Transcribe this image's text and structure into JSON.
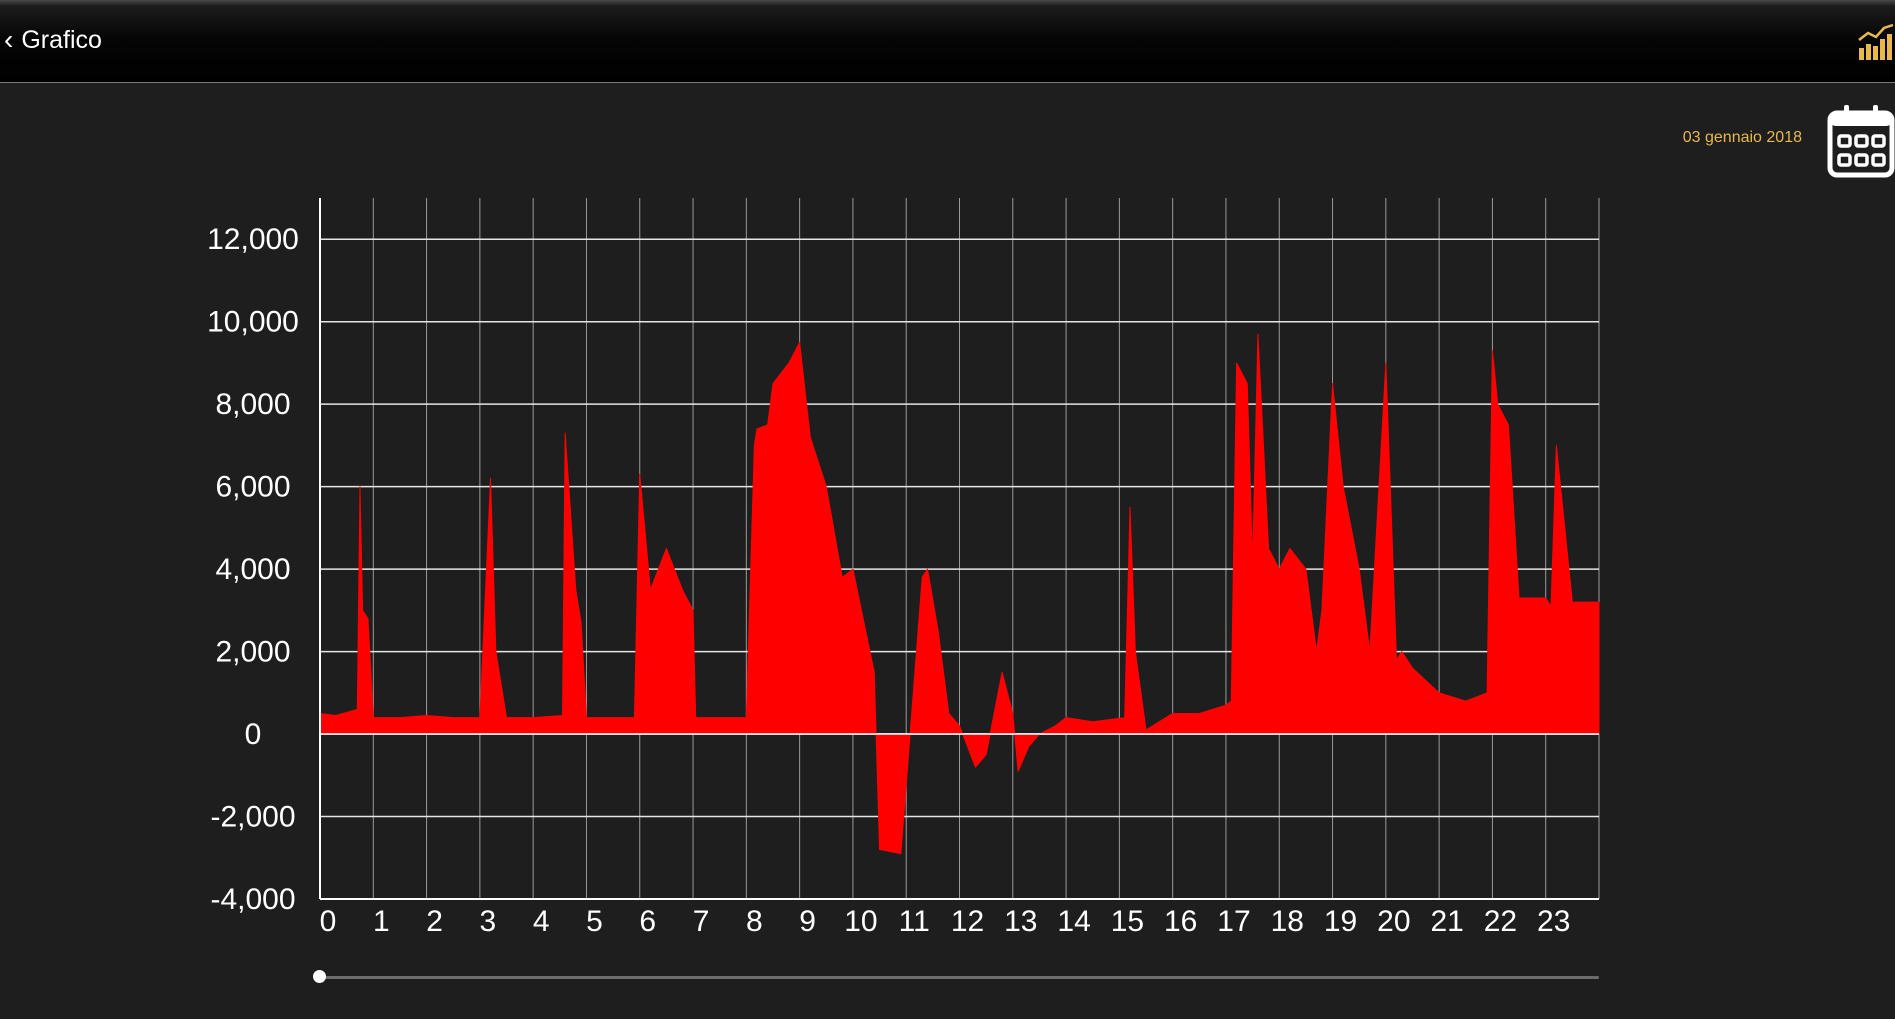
{
  "nav": {
    "back_chevron": "‹",
    "title": "Grafico",
    "chart_icon": "bar-line-chart-icon",
    "accent": "#e8b94a"
  },
  "date_label": "03 gennaio 2018",
  "calendar_icon": "calendar-icon",
  "slider": {
    "value": 0
  },
  "chart_data": {
    "type": "area",
    "title": "",
    "xlabel": "",
    "ylabel": "",
    "x_ticks": [
      "0",
      "1",
      "2",
      "3",
      "4",
      "5",
      "6",
      "7",
      "8",
      "9",
      "10",
      "11",
      "12",
      "13",
      "14",
      "15",
      "16",
      "17",
      "18",
      "19",
      "20",
      "21",
      "22",
      "23"
    ],
    "y_ticks": [
      "-4,000",
      "-2,000",
      "0",
      "2,000",
      "4,000",
      "6,000",
      "8,000",
      "10,000",
      "12,000"
    ],
    "xlim": [
      0,
      24
    ],
    "ylim": [
      -4000,
      13000
    ],
    "grid": true,
    "color": "#ff0000",
    "series": [
      {
        "x": [
          0,
          0.3,
          0.7,
          0.75,
          0.8,
          0.9,
          1.0,
          1.5,
          2.0,
          2.5,
          2.9,
          3.0,
          3.2,
          3.3,
          3.5,
          4.0,
          4.55,
          4.6,
          4.8,
          4.9,
          5.0,
          5.5,
          5.9,
          6.0,
          6.2,
          6.5,
          6.8,
          7.0,
          7.05,
          7.5,
          8.0,
          8.15,
          8.2,
          8.4,
          8.5,
          8.8,
          9.0,
          9.2,
          9.5,
          9.8,
          10.0,
          10.4,
          10.5,
          10.9,
          11.3,
          11.4,
          11.6,
          11.8,
          12.0,
          12.3,
          12.5,
          12.8,
          13.0,
          13.1,
          13.3,
          13.5,
          13.8,
          14.0,
          14.5,
          15.1,
          15.2,
          15.3,
          15.5,
          16.0,
          16.5,
          17.0,
          17.1,
          17.2,
          17.4,
          17.5,
          17.6,
          17.8,
          18.0,
          18.2,
          18.5,
          18.7,
          18.8,
          19.0,
          19.2,
          19.5,
          19.7,
          20.0,
          20.2,
          20.3,
          20.5,
          21.0,
          21.5,
          21.9,
          22.0,
          22.1,
          22.3,
          22.5,
          23.0,
          23.1,
          23.2,
          23.5,
          24.0
        ],
        "y": [
          500,
          450,
          600,
          6000,
          3000,
          2800,
          400,
          400,
          450,
          400,
          400,
          400,
          6200,
          2000,
          400,
          400,
          450,
          7300,
          3500,
          2700,
          400,
          400,
          400,
          6300,
          3500,
          4500,
          3500,
          3000,
          400,
          400,
          400,
          7000,
          7400,
          7500,
          8500,
          9000,
          9500,
          7200,
          6000,
          3800,
          4000,
          1500,
          -2800,
          -2900,
          3800,
          4000,
          2500,
          500,
          200,
          -800,
          -500,
          1500,
          500,
          -900,
          -300,
          0,
          200,
          400,
          300,
          400,
          5500,
          2000,
          100,
          500,
          500,
          700,
          800,
          9000,
          8500,
          4200,
          9700,
          4500,
          4000,
          4500,
          4000,
          2000,
          3000,
          8500,
          6000,
          4000,
          2000,
          9000,
          1800,
          2000,
          1600,
          1000,
          800,
          1000,
          9300,
          8000,
          7500,
          3300,
          3300,
          3100,
          7000,
          3200,
          3200
        ]
      }
    ]
  }
}
